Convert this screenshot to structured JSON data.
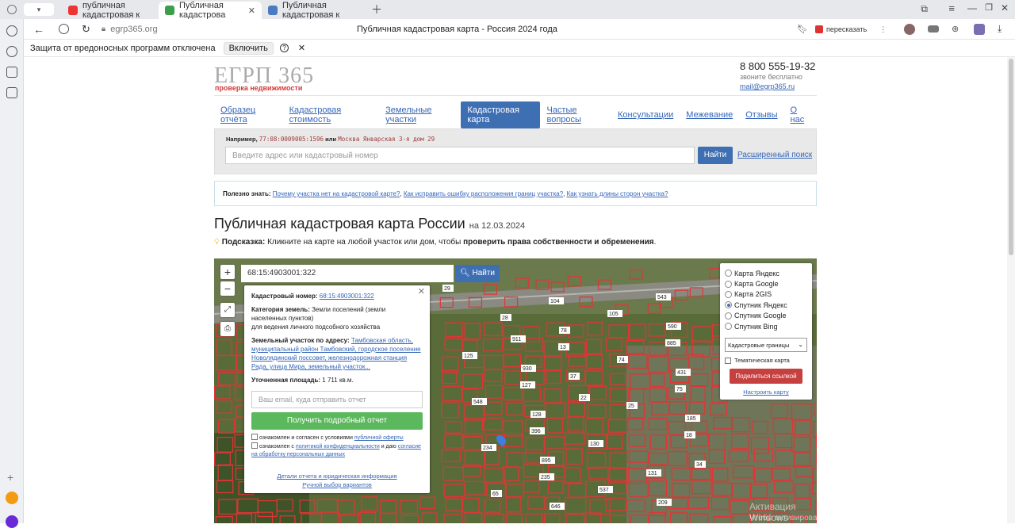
{
  "browser": {
    "tabs": [
      {
        "label": "публичная кадастровая к",
        "color": "#e33"
      },
      {
        "label": "Публичная кадастрова",
        "color": "#3a9e4a"
      },
      {
        "label": "Публичная кадастровая к",
        "color": "#4a7bc1"
      }
    ],
    "url": "egrp365.org",
    "page_title": "Публичная кадастровая карта - Россия 2024 года",
    "translate_label": "пересказать",
    "security_notice": "Защита от вредоносных программ отключена",
    "enable_label": "Включить"
  },
  "site": {
    "logo": "ЕГРП 365",
    "logo_sub": "проверка недвижимости",
    "phone": "8 800 555-19-32",
    "phone_note": "звоните бесплатно",
    "email": "mail@egrp365.ru"
  },
  "nav": [
    "Образец отчёта",
    "Кадастровая стоимость",
    "Земельные участки",
    "Кадастровая карта",
    "Частые вопросы",
    "Консультации",
    "Межевание",
    "Отзывы",
    "О нас"
  ],
  "search": {
    "example_prefix": "Например,",
    "example_code": "77:08:0009005:1596",
    "example_or": "или",
    "example_addr": "Москва Январская 3-я дом 29",
    "placeholder": "Введите адрес или кадастровый номер",
    "button": "Найти",
    "advanced": "Расширенный поиск"
  },
  "useful": {
    "prefix": "Полезно знать:",
    "link1": "Почему участка нет на кадастровой карте?",
    "link2": "Как исправить ошибку расположения границ участка?",
    "link3": "Как узнать длины сторон участка?"
  },
  "heading": {
    "title": "Публичная кадастровая карта России",
    "date": "на 12.03.2024"
  },
  "hint": {
    "label": "Подсказка:",
    "text": "Кликните на карте на любой участок или дом, чтобы",
    "bold": "проверить права собственности и обременения",
    "dot": "."
  },
  "map": {
    "search_value": "68:15:4903001:322",
    "search_button": "Найти",
    "popup": {
      "cad_label": "Кадастровый номер:",
      "cad_value": "68:15:4903001:322",
      "cat_label": "Категория земель:",
      "cat_value": "Земли поселений (земли населенных пунктов)",
      "use_value": "для ведения личного подсобного хозяйства",
      "addr_label": "Земельный участок по адресу:",
      "addr_value": "Тамбовская область, муниципальный район Тамбовский, городское поселение Новолядинский поссовет, железнодорожная станция Рада, улица Мира, земельный участок...",
      "area_label": "Уточненная площадь:",
      "area_value": "1 711 кв.м.",
      "email_placeholder": "Ваш email, куда отправить отчет",
      "get_report": "Получить подробный отчет",
      "agree1_pre": "ознакомлен и согласен с условиями",
      "agree1_link": "публичной оферты",
      "agree2_pre": "ознакомлен с",
      "agree2_link": "политикой конфиденциальности",
      "agree2_mid": "и даю",
      "agree2_link2": "согласие на обработку персональных данных",
      "details": "Детали отчета и юридическая информация",
      "manual": "Ручной выбор вариантов"
    },
    "layers": [
      "Карта Яндекс",
      "Карта Google",
      "Карта 2GIS",
      "Спутник Яндекс",
      "Спутник Google",
      "Спутник Bing"
    ],
    "selected_layer": "Спутник Яндекс",
    "overlay_select": "Кадастровые границы",
    "thematic": "Тематическая карта",
    "share": "Поделиться ссылкой",
    "configure": "Настроить карту",
    "parcel_labels": [
      "29",
      "28",
      "13",
      "37",
      "25",
      "18",
      "34",
      "65",
      "104",
      "78",
      "74",
      "75",
      "185",
      "234",
      "235",
      "646",
      "105",
      "885",
      "431",
      "548",
      "396",
      "895",
      "537",
      "543",
      "590",
      "125",
      "127",
      "128",
      "130",
      "131",
      "209",
      "912",
      "911",
      "930",
      "22"
    ],
    "watermark1": "Активация Windows",
    "watermark2": "Чтобы активировать Windows, перейдите в раздел \"Параметры\"."
  }
}
